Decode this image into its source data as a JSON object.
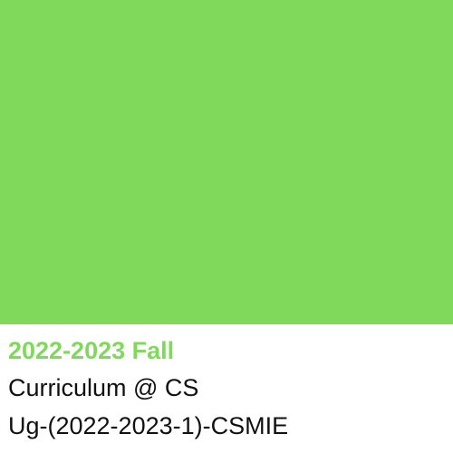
{
  "card": {
    "swatch_color": "#80D95A",
    "term": "2022-2023 Fall",
    "term_color": "#80D95A",
    "subtitle": "Curriculum @ CS",
    "code": "Ug-(2022-2023-1)-CSMIE"
  }
}
